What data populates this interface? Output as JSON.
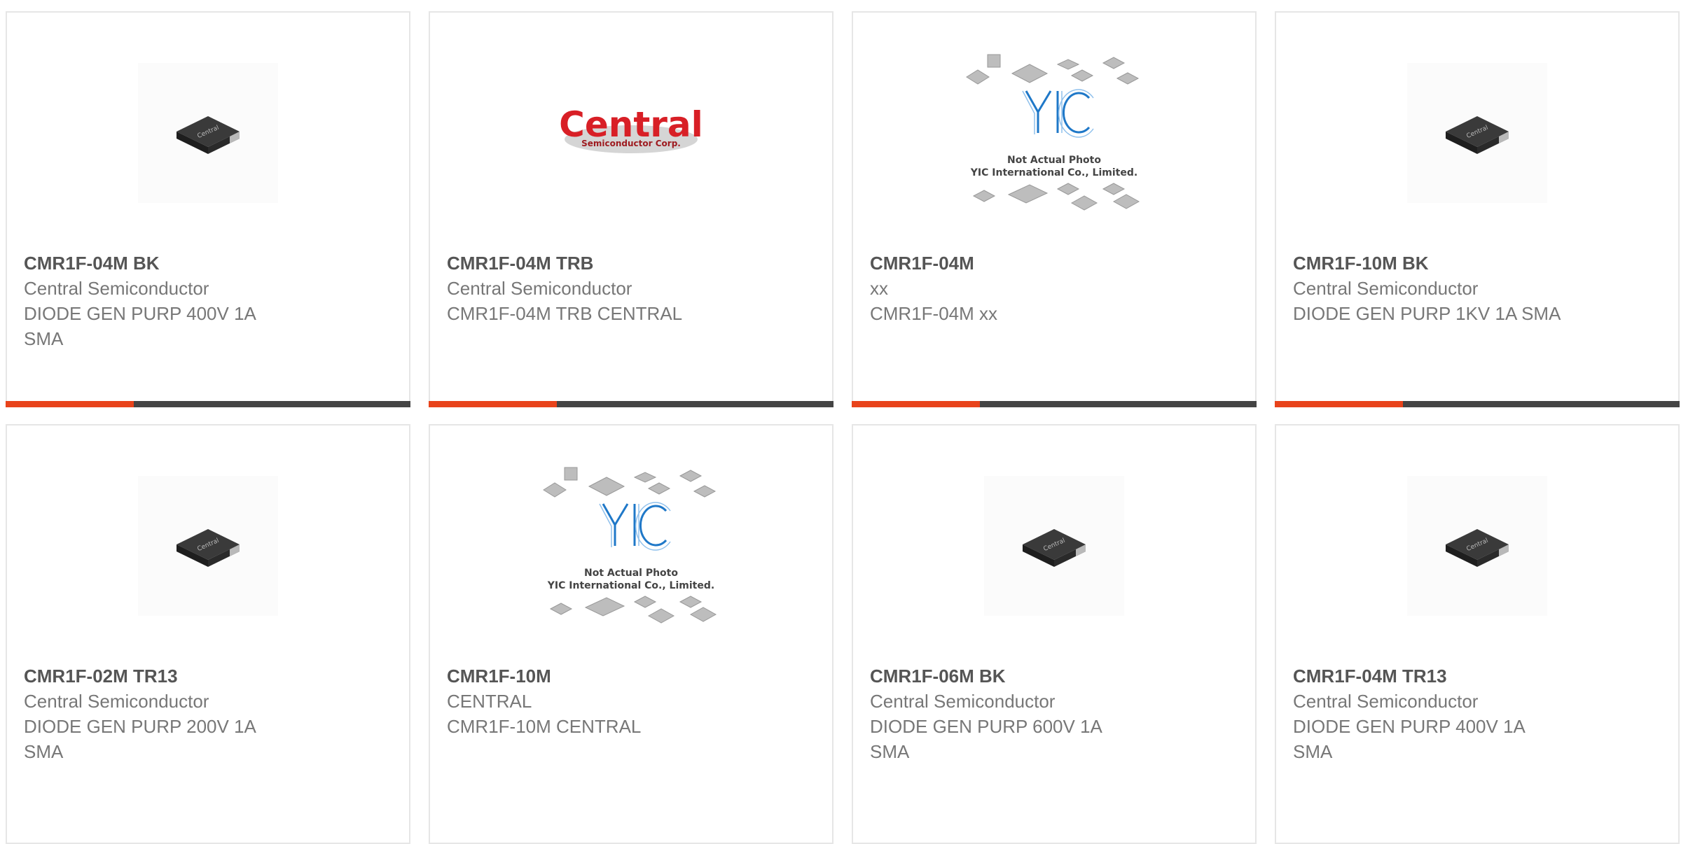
{
  "products": [
    {
      "part": "CMR1F-04M BK",
      "maker": "Central Semiconductor",
      "desc": "DIODE GEN PURP 400V 1A SMA",
      "image": "diode-sma-package"
    },
    {
      "part": "CMR1F-04M TRB",
      "maker": "Central Semiconductor",
      "desc": "CMR1F-04M TRB CENTRAL",
      "image": "central-semiconductor-logo"
    },
    {
      "part": "CMR1F-04M",
      "maker": "xx",
      "desc": "CMR1F-04M xx",
      "image": "yic-placeholder"
    },
    {
      "part": "CMR1F-10M BK",
      "maker": "Central Semiconductor",
      "desc": "DIODE GEN PURP 1KV 1A SMA",
      "image": "diode-sma-package"
    },
    {
      "part": "CMR1F-02M TR13",
      "maker": "Central Semiconductor",
      "desc": "DIODE GEN PURP 200V 1A SMA",
      "image": "diode-sma-package"
    },
    {
      "part": "CMR1F-10M",
      "maker": "CENTRAL",
      "desc": "CMR1F-10M CENTRAL",
      "image": "yic-placeholder"
    },
    {
      "part": "CMR1F-06M BK",
      "maker": "Central Semiconductor",
      "desc": "DIODE GEN PURP 600V 1A SMA",
      "image": "diode-sma-package"
    },
    {
      "part": "CMR1F-04M TR13",
      "maker": "Central Semiconductor",
      "desc": "DIODE GEN PURP 400V 1A SMA",
      "image": "diode-sma-package"
    }
  ],
  "images": {
    "central_logo_word": "Central",
    "central_logo_tm": "™",
    "central_logo_sub": "Semiconductor Corp.",
    "chip_marking": "Central",
    "yic_line1": "Not Actual Photo",
    "yic_line2": "YIC International Co., Limited."
  },
  "colors": {
    "accent": "#e8431b",
    "bar": "#444444",
    "border": "#e6e6e6",
    "logo_red": "#d81f26",
    "yic_blue": "#1f78c8"
  }
}
